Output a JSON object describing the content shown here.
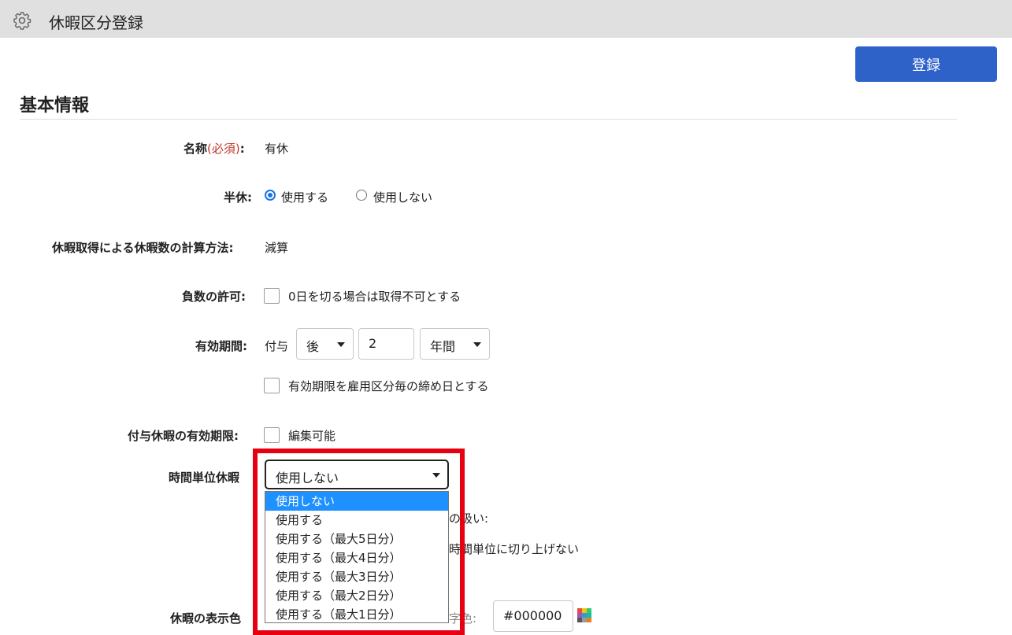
{
  "header": {
    "title": "休暇区分登録"
  },
  "toolbar": {
    "submit_label": "登録"
  },
  "section": {
    "title": "基本情報"
  },
  "fields": {
    "name": {
      "label": "名称",
      "required": "(必須)",
      "colon": ":",
      "value": "有休"
    },
    "half_day": {
      "label": "半休:",
      "option_use": "使用する",
      "option_no": "使用しない"
    },
    "calc_method": {
      "label": "休暇取得による休暇数の計算方法:",
      "value": "減算"
    },
    "negative": {
      "label": "負数の許可:",
      "checkbox_label": "0日を切る場合は取得不可とする"
    },
    "validity": {
      "label": "有効期間:",
      "prefix": "付与",
      "direction": "後",
      "amount": "2",
      "unit": "年間",
      "closing_checkbox_label": "有効期限を雇用区分毎の締め日とする"
    },
    "granted_expiry": {
      "label": "付与休暇の有効期限:",
      "checkbox_label": "編集可能"
    },
    "hourly": {
      "label": "時間単位休暇",
      "selected": "使用しない",
      "options": [
        "使用しない",
        "使用する",
        "使用する（最大5日分）",
        "使用する（最大4日分）",
        "使用する（最大3日分）",
        "使用する（最大2日分）",
        "使用する（最大1日分）"
      ],
      "partial_text_1": "の扱い:",
      "partial_text_2": "時間単位に切り上げない"
    },
    "display_color": {
      "label": "休暇の表示色",
      "text_color_label_partial": "字色:",
      "text_color_value": "#000000"
    }
  },
  "colors": {
    "accent": "#2f62c9",
    "highlight_border": "#e60012",
    "selected_option": "#1e90ff",
    "required": "#c0392b"
  }
}
